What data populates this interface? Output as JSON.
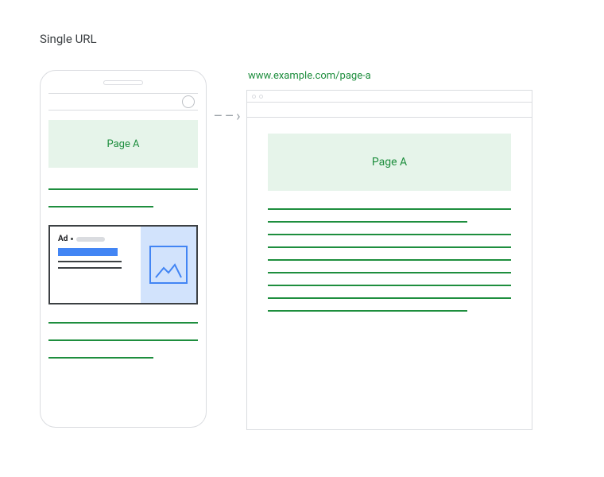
{
  "title": "Single URL",
  "url": "www.example.com/page-a",
  "phone": {
    "header": "Page A"
  },
  "desktop": {
    "header": "Page A"
  },
  "ad": {
    "label": "Ad"
  }
}
